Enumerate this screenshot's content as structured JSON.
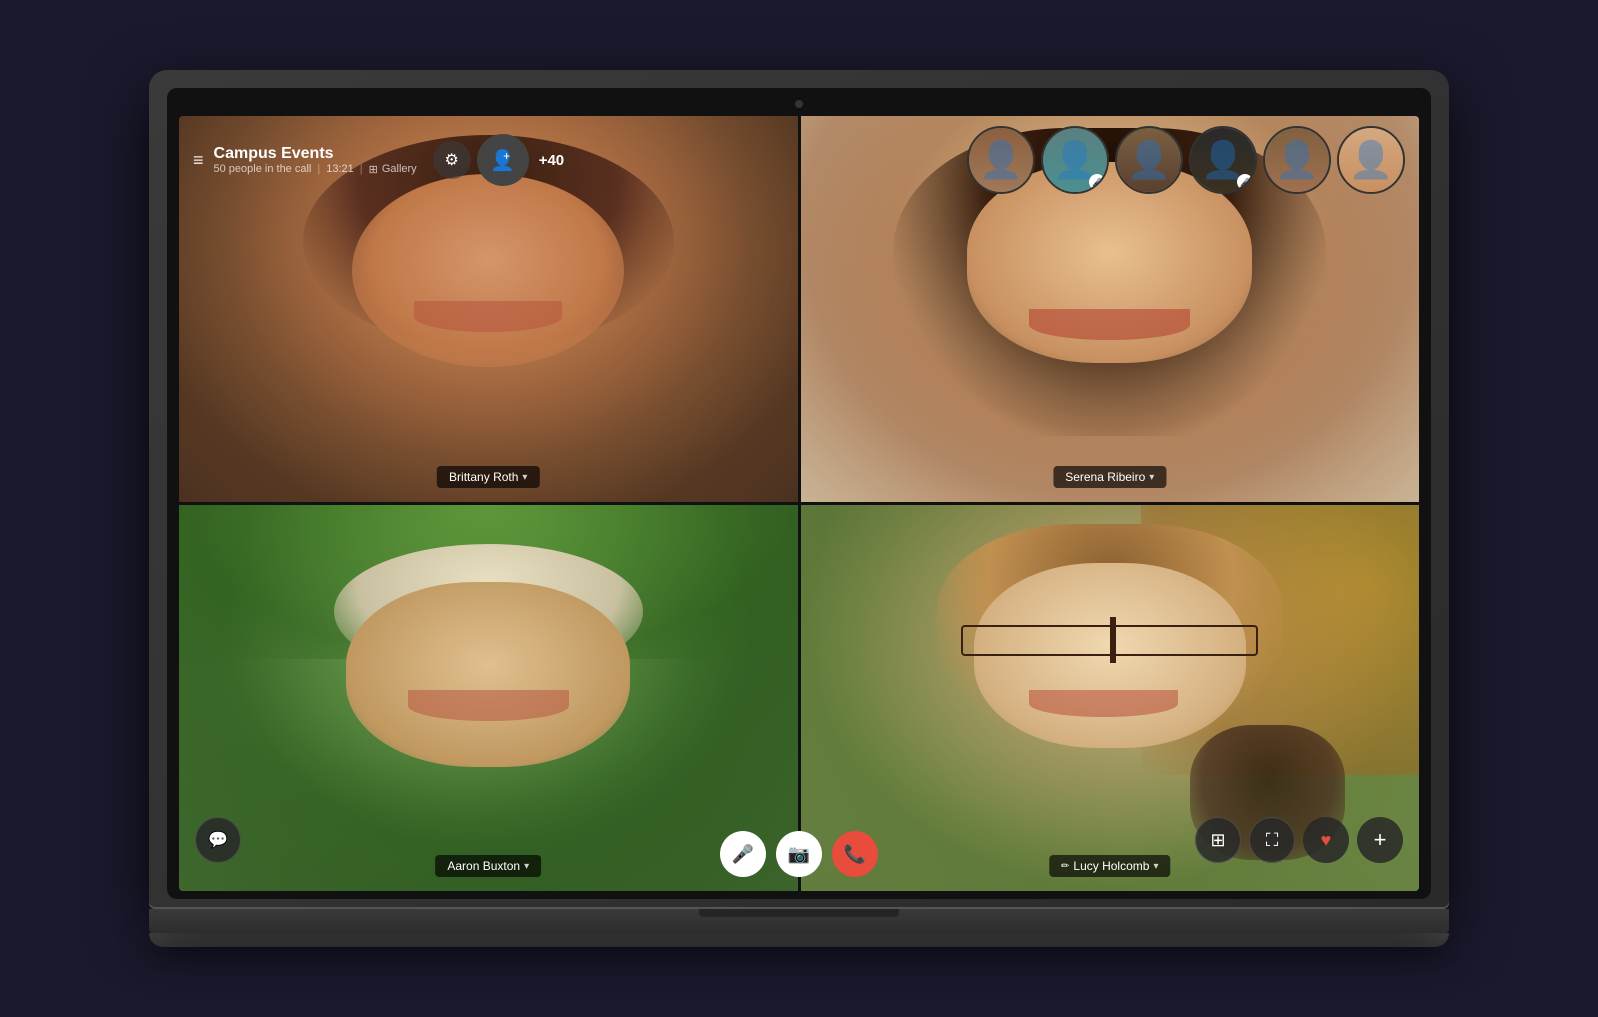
{
  "app": {
    "title": "Campus Events",
    "meta": {
      "people_count": "50 people in the call",
      "time": "13:21",
      "view_mode": "Gallery"
    }
  },
  "participants": [
    {
      "id": "brittany-roth",
      "name": "Brittany Roth",
      "muted": false,
      "position": "top-left"
    },
    {
      "id": "serena-ribeiro",
      "name": "Serena Ribeiro",
      "muted": false,
      "position": "top-right"
    },
    {
      "id": "aaron-buxton",
      "name": "Aaron Buxton",
      "muted": false,
      "position": "bottom-left"
    },
    {
      "id": "lucy-holcomb",
      "name": "Lucy Holcomb",
      "muted": false,
      "position": "bottom-right"
    }
  ],
  "thumbnails": [
    {
      "id": "thumb-1",
      "initials": "👤",
      "muted": false
    },
    {
      "id": "thumb-2",
      "initials": "👤",
      "muted": true
    },
    {
      "id": "thumb-3",
      "initials": "👤",
      "muted": false
    },
    {
      "id": "thumb-4",
      "initials": "👤",
      "muted": true
    },
    {
      "id": "thumb-5",
      "initials": "👤",
      "muted": false
    },
    {
      "id": "thumb-6",
      "initials": "👤",
      "muted": false
    }
  ],
  "controls": {
    "mic_label": "🎤",
    "camera_label": "📷",
    "end_call_label": "📞",
    "chat_label": "💬",
    "layout_label": "⊞",
    "fullscreen_label": "⛶",
    "heart_label": "♥",
    "more_label": "+"
  },
  "header": {
    "hamburger": "≡",
    "settings": "⚙",
    "add_people": "👤+",
    "extra_count": "+40"
  }
}
